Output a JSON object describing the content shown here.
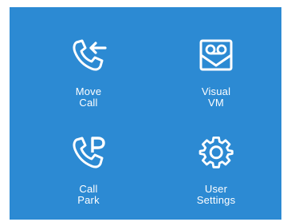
{
  "theme": {
    "panel_background": "#2c8ad3",
    "icon_color": "#ffffff",
    "text_color": "#ffffff",
    "page_background": "#ffffff"
  },
  "tiles": [
    {
      "label": "Move\nCall",
      "icon": "phone-arrow-left-icon"
    },
    {
      "label": "Visual\nVM",
      "icon": "voicemail-envelope-icon"
    },
    {
      "label": "Call\nPark",
      "icon": "phone-park-icon"
    },
    {
      "label": "User\nSettings",
      "icon": "gear-icon"
    }
  ]
}
